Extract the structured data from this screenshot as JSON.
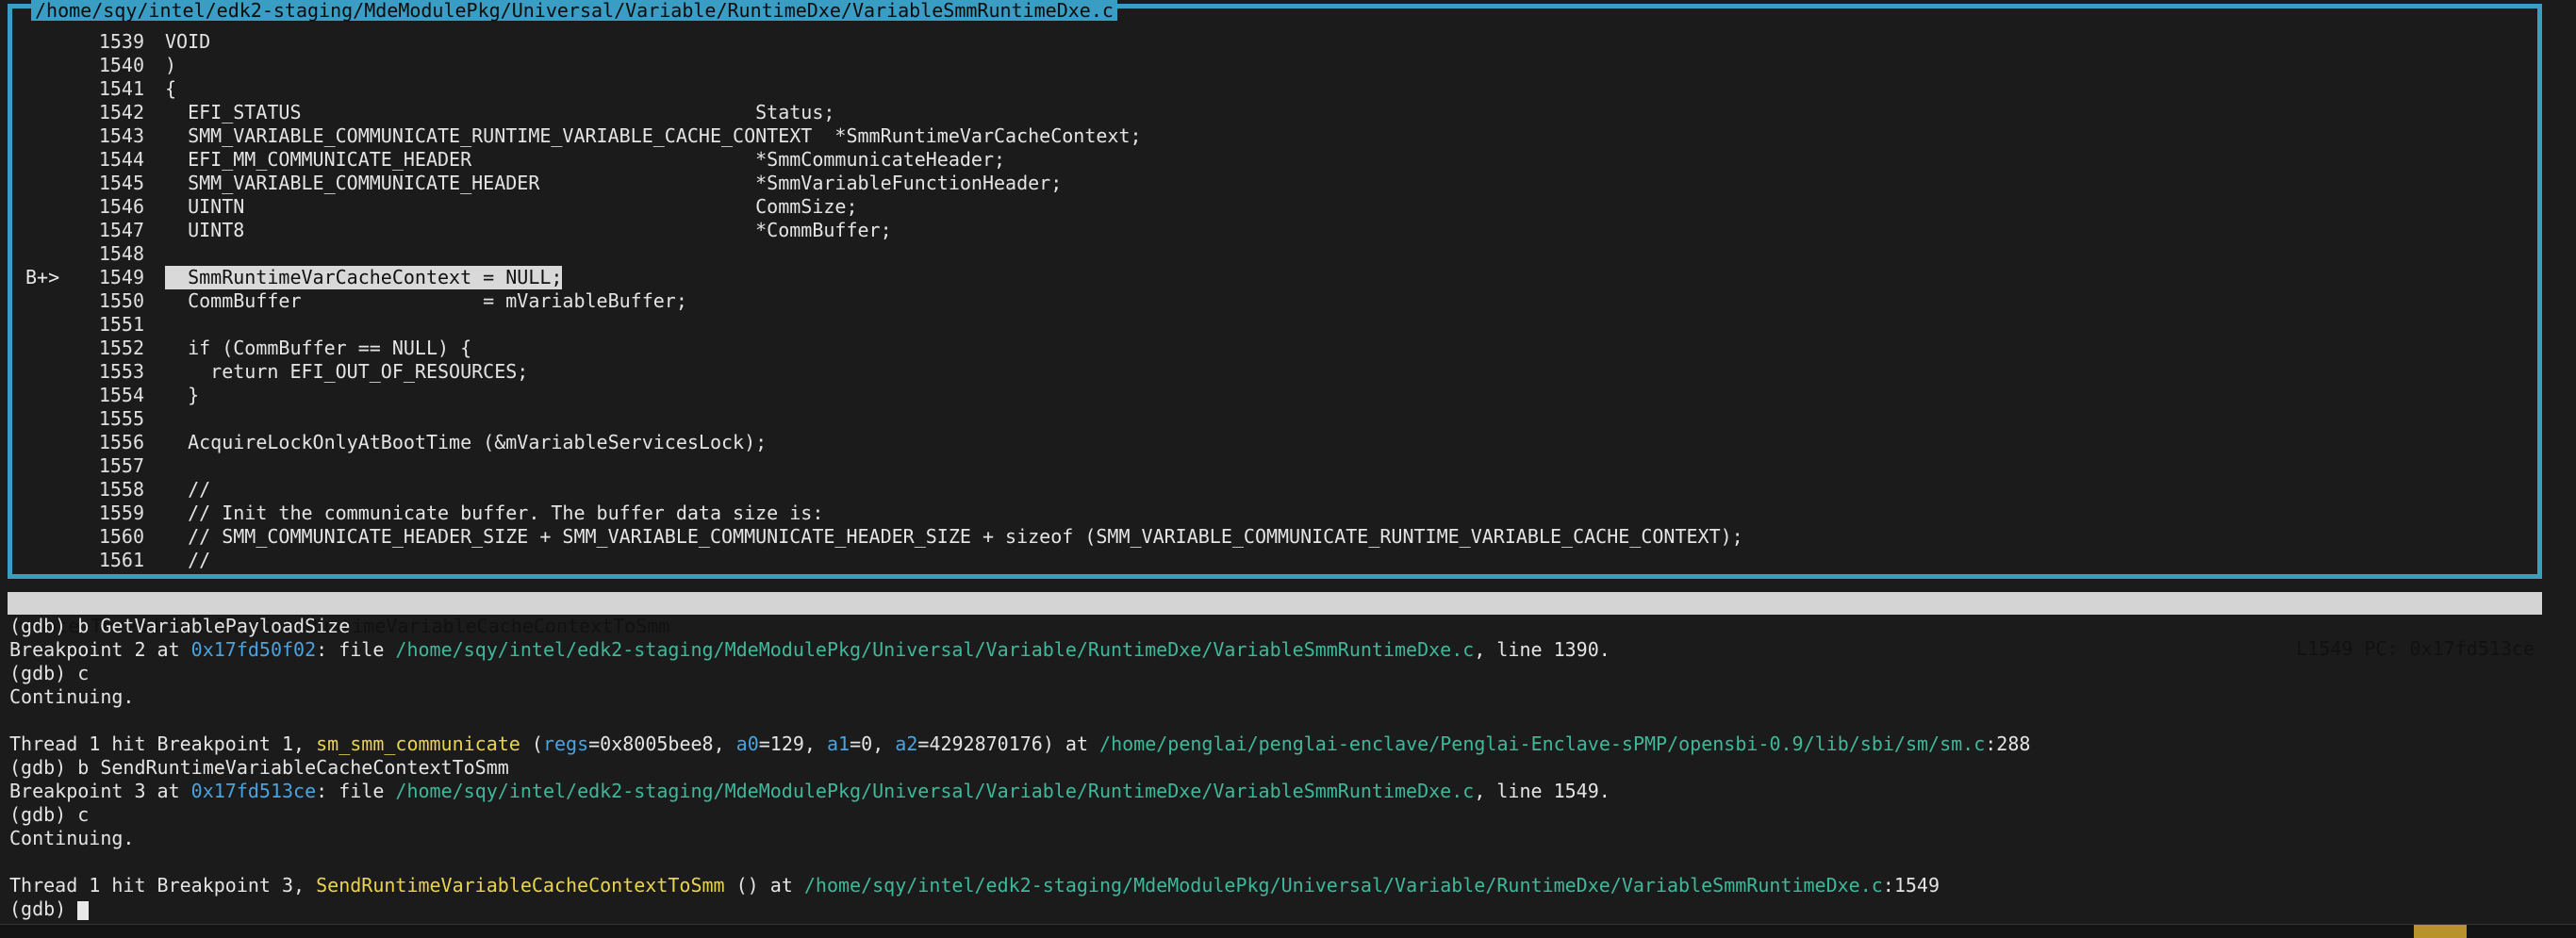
{
  "source_window": {
    "title": "/home/sqy/intel/edk2-staging/MdeModulePkg/Universal/Variable/RuntimeDxe/VariableSmmRuntimeDxe.c",
    "lines": [
      {
        "marker": "",
        "no": "1539",
        "code": "VOID"
      },
      {
        "marker": "",
        "no": "1540",
        "code": ")"
      },
      {
        "marker": "",
        "no": "1541",
        "code": "{"
      },
      {
        "marker": "",
        "no": "1542",
        "code": "  EFI_STATUS                                        Status;"
      },
      {
        "marker": "",
        "no": "1543",
        "code": "  SMM_VARIABLE_COMMUNICATE_RUNTIME_VARIABLE_CACHE_CONTEXT  *SmmRuntimeVarCacheContext;"
      },
      {
        "marker": "",
        "no": "1544",
        "code": "  EFI_MM_COMMUNICATE_HEADER                         *SmmCommunicateHeader;"
      },
      {
        "marker": "",
        "no": "1545",
        "code": "  SMM_VARIABLE_COMMUNICATE_HEADER                   *SmmVariableFunctionHeader;"
      },
      {
        "marker": "",
        "no": "1546",
        "code": "  UINTN                                             CommSize;"
      },
      {
        "marker": "",
        "no": "1547",
        "code": "  UINT8                                             *CommBuffer;"
      },
      {
        "marker": "",
        "no": "1548",
        "code": ""
      },
      {
        "marker": "B+>",
        "no": "1549",
        "code": "  SmmRuntimeVarCacheContext = NULL;",
        "highlight": true
      },
      {
        "marker": "",
        "no": "1550",
        "code": "  CommBuffer                = mVariableBuffer;"
      },
      {
        "marker": "",
        "no": "1551",
        "code": ""
      },
      {
        "marker": "",
        "no": "1552",
        "code": "  if (CommBuffer == NULL) {"
      },
      {
        "marker": "",
        "no": "1553",
        "code": "    return EFI_OUT_OF_RESOURCES;"
      },
      {
        "marker": "",
        "no": "1554",
        "code": "  }"
      },
      {
        "marker": "",
        "no": "1555",
        "code": ""
      },
      {
        "marker": "",
        "no": "1556",
        "code": "  AcquireLockOnlyAtBootTime (&mVariableServicesLock);"
      },
      {
        "marker": "",
        "no": "1557",
        "code": ""
      },
      {
        "marker": "",
        "no": "1558",
        "code": "  //"
      },
      {
        "marker": "",
        "no": "1559",
        "code": "  // Init the communicate buffer. The buffer data size is:"
      },
      {
        "marker": "",
        "no": "1560",
        "code": "  // SMM_COMMUNICATE_HEADER_SIZE + SMM_VARIABLE_COMMUNICATE_HEADER_SIZE + sizeof (SMM_VARIABLE_COMMUNICATE_RUNTIME_VARIABLE_CACHE_CONTEXT);"
      },
      {
        "marker": "",
        "no": "1561",
        "code": "  //"
      }
    ]
  },
  "status_bar": {
    "left": "remote Thread 1.1 In: SendRuntimeVariableCacheContextToSmm",
    "right": "L1549 PC: 0x17fd513ce"
  },
  "console": {
    "l1": "(gdb) b GetVariablePayloadSize",
    "l2_a": "Breakpoint 2 at ",
    "l2_addr": "0x17fd50f02",
    "l2_b": ": file ",
    "l2_path": "/home/sqy/intel/edk2-staging/MdeModulePkg/Universal/Variable/RuntimeDxe/VariableSmmRuntimeDxe.c",
    "l2_c": ", line 1390.",
    "l3": "(gdb) c",
    "l4": "Continuing.",
    "l5": "",
    "l6_a": "Thread 1 hit Breakpoint 1, ",
    "l6_func": "sm_smm_communicate",
    "l6_b": " (",
    "l6_arg1": "regs",
    "l6_c": "=0x8005bee8, ",
    "l6_arg2": "a0",
    "l6_d": "=129, ",
    "l6_arg3": "a1",
    "l6_e": "=0, ",
    "l6_arg4": "a2",
    "l6_f": "=4292870176) at ",
    "l6_path": "/home/penglai/penglai-enclave/Penglai-Enclave-sPMP/opensbi-0.9/lib/sbi/sm/sm.c",
    "l6_g": ":288",
    "l7": "(gdb) b SendRuntimeVariableCacheContextToSmm",
    "l8_a": "Breakpoint 3 at ",
    "l8_addr": "0x17fd513ce",
    "l8_b": ": file ",
    "l8_path": "/home/sqy/intel/edk2-staging/MdeModulePkg/Universal/Variable/RuntimeDxe/VariableSmmRuntimeDxe.c",
    "l8_c": ", line 1549.",
    "l9": "(gdb) c",
    "l10": "Continuing.",
    "l11": "",
    "l12_a": "Thread 1 hit Breakpoint 3, ",
    "l12_func": "SendRuntimeVariableCacheContextToSmm",
    "l12_b": " () at ",
    "l12_path": "/home/sqy/intel/edk2-staging/MdeModulePkg/Universal/Variable/RuntimeDxe/VariableSmmRuntimeDxe.c",
    "l12_c": ":1549",
    "prompt": "(gdb) "
  },
  "colors": {
    "frame": "#3a9dc4",
    "address": "#4aa3df",
    "path": "#3fb89a",
    "function": "#e8d44d"
  }
}
